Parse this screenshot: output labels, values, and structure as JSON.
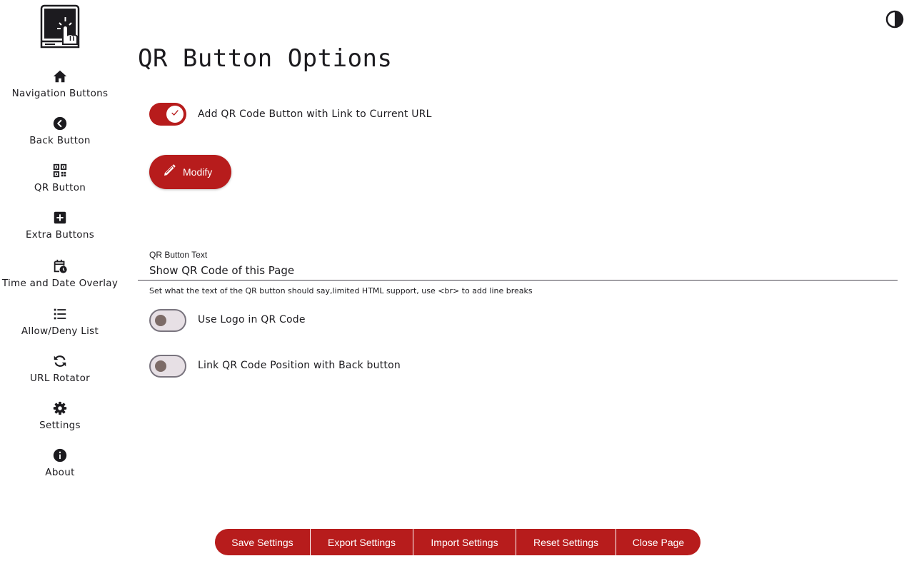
{
  "app": {
    "title": "QR Button Options",
    "accent_color": "#b71c1c"
  },
  "sidebar": {
    "logo_icon": "touchscreen-kiosk-icon",
    "items": [
      {
        "label": "Navigation Buttons",
        "icon": "home-icon"
      },
      {
        "label": "Back Button",
        "icon": "back-circle-icon"
      },
      {
        "label": "QR Button",
        "icon": "qr-code-icon"
      },
      {
        "label": "Extra Buttons",
        "icon": "add-box-icon"
      },
      {
        "label": "Time and Date Overlay",
        "icon": "calendar-clock-icon"
      },
      {
        "label": "Allow/Deny List",
        "icon": "list-icon"
      },
      {
        "label": "URL Rotator",
        "icon": "rotate-icon"
      },
      {
        "label": "Settings",
        "icon": "gear-icon"
      },
      {
        "label": "About",
        "icon": "info-icon"
      }
    ]
  },
  "header": {
    "theme_toggle_icon": "contrast-icon"
  },
  "main": {
    "qr_toggle": {
      "label": "Add QR Code Button with Link to Current URL",
      "checked": true
    },
    "modify_button": {
      "label": "Modify",
      "icon": "pencil-icon"
    },
    "qr_text_field": {
      "label": "QR Button Text",
      "value": "Show QR Code of this Page",
      "helper": "Set what the text of the QR button should say,limited HTML support, use <br> to add line breaks"
    },
    "logo_toggle": {
      "label": "Use Logo in QR Code",
      "checked": false
    },
    "link_position_toggle": {
      "label": "Link QR Code Position with Back button",
      "checked": false
    }
  },
  "footer": {
    "buttons": [
      {
        "label": "Save Settings"
      },
      {
        "label": "Export Settings"
      },
      {
        "label": "Import Settings"
      },
      {
        "label": "Reset Settings"
      },
      {
        "label": "Close Page"
      }
    ]
  }
}
